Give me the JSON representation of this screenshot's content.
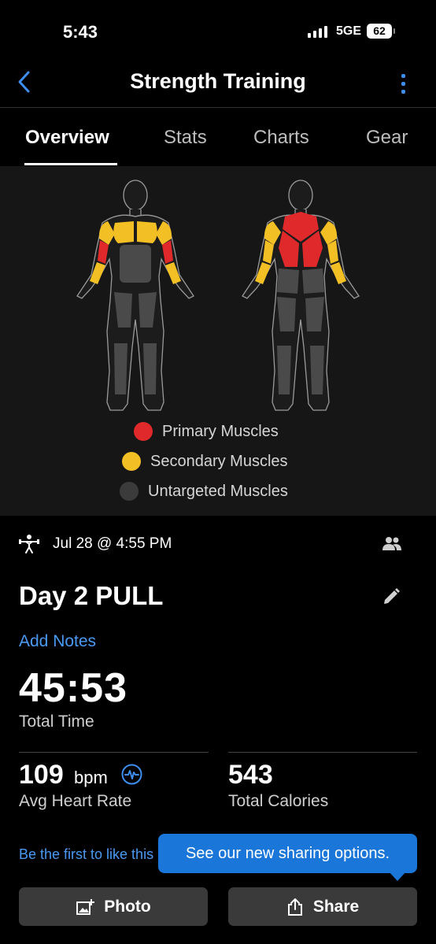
{
  "status": {
    "time": "5:43",
    "network": "5GE",
    "battery": "62"
  },
  "header": {
    "title": "Strength Training"
  },
  "tabs": [
    "Overview",
    "Stats",
    "Charts",
    "Gear"
  ],
  "legend": [
    {
      "label": "Primary Muscles",
      "color": "#e0292b"
    },
    {
      "label": "Secondary Muscles",
      "color": "#f2bf25"
    },
    {
      "label": "Untargeted Muscles",
      "color": "#3b3b3b"
    }
  ],
  "activity": {
    "datetime": "Jul 28 @ 4:55 PM",
    "name": "Day 2 PULL",
    "add_notes": "Add Notes"
  },
  "metrics": {
    "total_time": "45:53",
    "total_time_label": "Total Time",
    "heart_rate": "109",
    "heart_rate_unit": "bpm",
    "heart_rate_label": "Avg Heart Rate",
    "calories": "543",
    "calories_label": "Total Calories"
  },
  "social": {
    "like_text": "Be the first to like this"
  },
  "tooltip": {
    "text": "See our new sharing options."
  },
  "actions": {
    "photo": "Photo",
    "share": "Share"
  },
  "colors": {
    "accent": "#3d8ef0",
    "tooltip": "#1a76d8",
    "button": "#3a3a3a"
  }
}
